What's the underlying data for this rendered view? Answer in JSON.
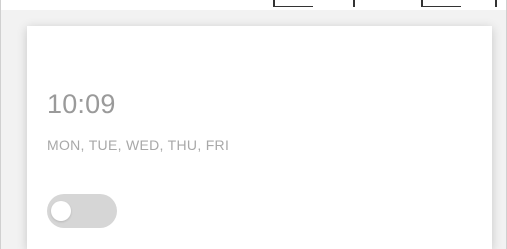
{
  "alarm": {
    "time": "10:09",
    "days": "MON, TUE, WED, THU, FRI",
    "enabled": false
  },
  "colors": {
    "page_background": "#f2f2f2",
    "card_background": "#ffffff",
    "text_muted": "#9a9a9a",
    "toggle_off": "#d6d6d6"
  }
}
